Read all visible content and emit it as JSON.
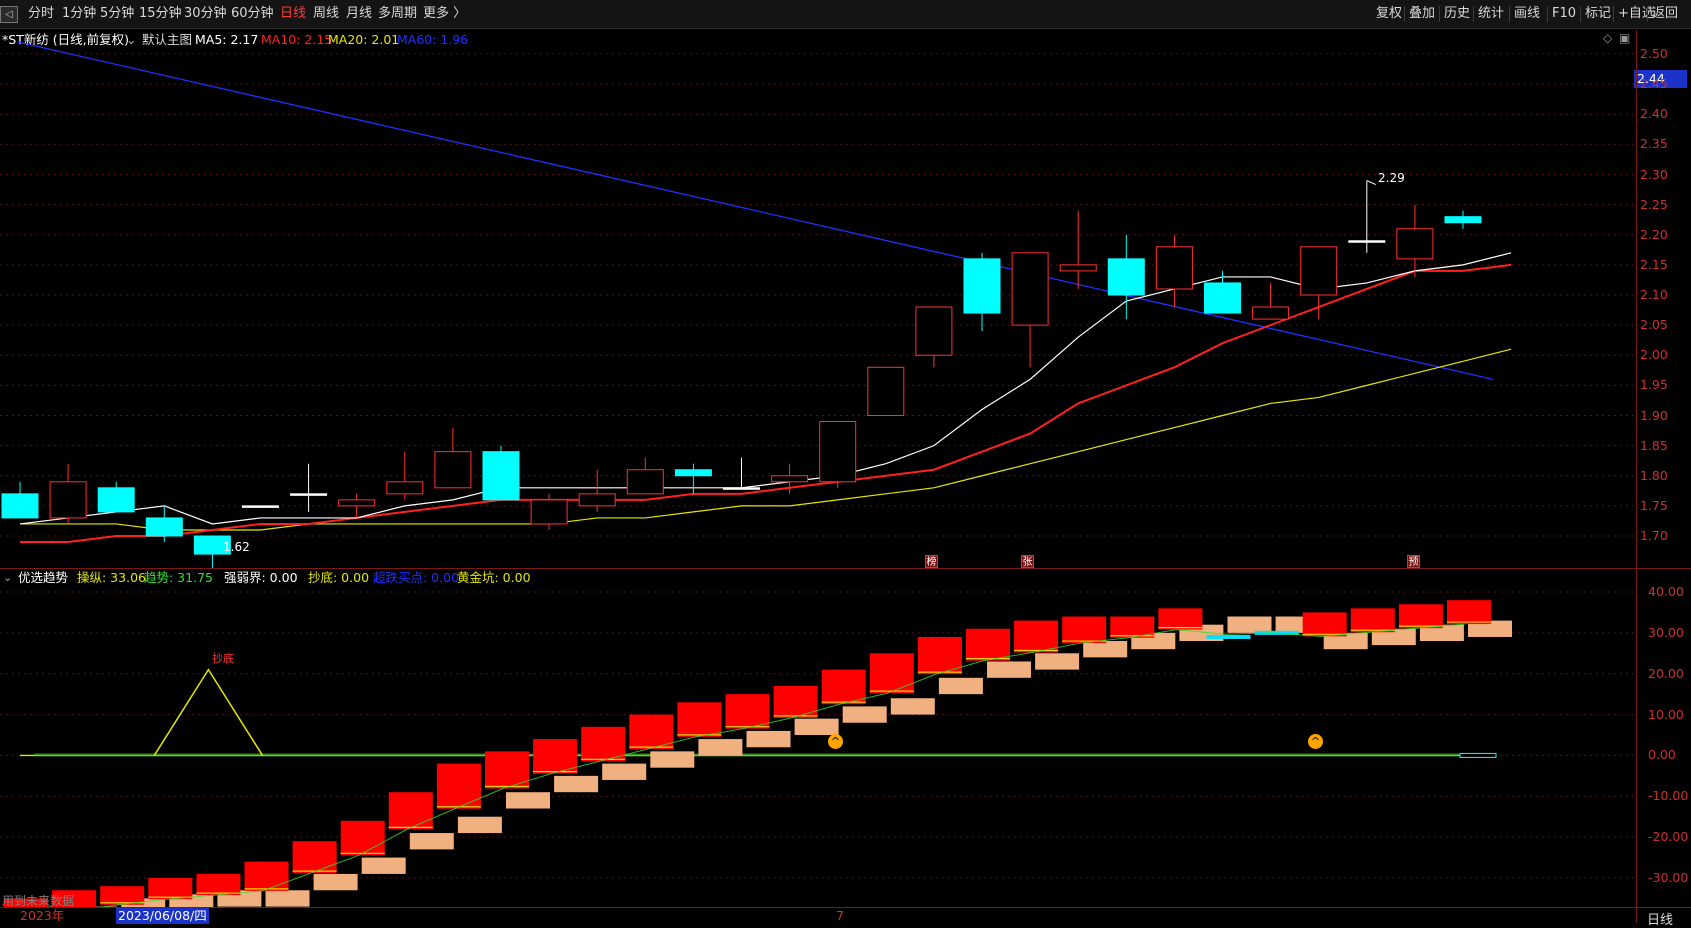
{
  "toolbar": {
    "periods": [
      {
        "label": "分时",
        "active": false
      },
      {
        "label": "1分钟",
        "active": false
      },
      {
        "label": "5分钟",
        "active": false
      },
      {
        "label": "15分钟",
        "active": false
      },
      {
        "label": "30分钟",
        "active": false
      },
      {
        "label": "60分钟",
        "active": false
      },
      {
        "label": "日线",
        "active": true
      },
      {
        "label": "周线",
        "active": false
      },
      {
        "label": "月线",
        "active": false
      },
      {
        "label": "多周期",
        "active": false
      },
      {
        "label": "更多 〉",
        "active": false
      }
    ],
    "actions": [
      "复权",
      "叠加",
      "历史",
      "统计",
      "画线",
      "F10",
      "标记",
      "+自选",
      "返回"
    ]
  },
  "main_chart": {
    "title": "*ST新纺 (日线,前复权)",
    "template": "默认主图",
    "ma5": {
      "label": "MA5: 2.17",
      "color": "#ffffff"
    },
    "ma10": {
      "label": "MA10: 2.15",
      "color": "#ff2020"
    },
    "ma20": {
      "label": "MA20: 2.01",
      "color": "#e6e600"
    },
    "ma60": {
      "label": "MA60: 1.96",
      "color": "#2030ff"
    },
    "current_price": "2.44",
    "high_label": "2.29",
    "low_label": "1.62",
    "price_ticks": [
      "2.50",
      "2.45",
      "2.40",
      "2.35",
      "2.30",
      "2.25",
      "2.20",
      "2.15",
      "2.10",
      "2.05",
      "2.00",
      "1.95",
      "1.90",
      "1.85",
      "1.80",
      "1.75",
      "1.70"
    ],
    "markers": [
      {
        "label": "榜"
      },
      {
        "label": "张"
      },
      {
        "label": "预"
      }
    ],
    "colors": {
      "up": "#ff3030",
      "down": "#00ffff",
      "background": "#000000",
      "grid": "#5a1010"
    }
  },
  "chart_data": {
    "type": "candlestick",
    "ylim": [
      1.6,
      2.52
    ],
    "candles": [
      {
        "o": 1.77,
        "h": 1.79,
        "l": 1.73,
        "c": 1.73
      },
      {
        "o": 1.73,
        "h": 1.82,
        "l": 1.72,
        "c": 1.79
      },
      {
        "o": 1.78,
        "h": 1.79,
        "l": 1.74,
        "c": 1.74
      },
      {
        "o": 1.73,
        "h": 1.75,
        "l": 1.69,
        "c": 1.7
      },
      {
        "o": 1.7,
        "h": 1.7,
        "l": 1.62,
        "c": 1.67
      },
      {
        "o": 1.75,
        "h": 1.75,
        "l": 1.75,
        "c": 1.75
      },
      {
        "o": 1.77,
        "h": 1.82,
        "l": 1.74,
        "c": 1.77
      },
      {
        "o": 1.75,
        "h": 1.77,
        "l": 1.73,
        "c": 1.76
      },
      {
        "o": 1.77,
        "h": 1.84,
        "l": 1.76,
        "c": 1.79
      },
      {
        "o": 1.78,
        "h": 1.88,
        "l": 1.78,
        "c": 1.84
      },
      {
        "o": 1.84,
        "h": 1.85,
        "l": 1.76,
        "c": 1.76
      },
      {
        "o": 1.72,
        "h": 1.77,
        "l": 1.71,
        "c": 1.76
      },
      {
        "o": 1.75,
        "h": 1.81,
        "l": 1.74,
        "c": 1.77
      },
      {
        "o": 1.77,
        "h": 1.83,
        "l": 1.77,
        "c": 1.81
      },
      {
        "o": 1.81,
        "h": 1.82,
        "l": 1.77,
        "c": 1.8
      },
      {
        "o": 1.78,
        "h": 1.83,
        "l": 1.78,
        "c": 1.78
      },
      {
        "o": 1.79,
        "h": 1.82,
        "l": 1.77,
        "c": 1.8
      },
      {
        "o": 1.79,
        "h": 1.89,
        "l": 1.78,
        "c": 1.89
      },
      {
        "o": 1.9,
        "h": 1.98,
        "l": 1.9,
        "c": 1.98
      },
      {
        "o": 2.0,
        "h": 2.08,
        "l": 1.98,
        "c": 2.08
      },
      {
        "o": 2.16,
        "h": 2.17,
        "l": 2.04,
        "c": 2.07
      },
      {
        "o": 2.05,
        "h": 2.17,
        "l": 1.98,
        "c": 2.17
      },
      {
        "o": 2.14,
        "h": 2.24,
        "l": 2.11,
        "c": 2.15
      },
      {
        "o": 2.16,
        "h": 2.2,
        "l": 2.06,
        "c": 2.1
      },
      {
        "o": 2.11,
        "h": 2.2,
        "l": 2.08,
        "c": 2.18
      },
      {
        "o": 2.12,
        "h": 2.14,
        "l": 2.07,
        "c": 2.07
      },
      {
        "o": 2.06,
        "h": 2.12,
        "l": 2.06,
        "c": 2.08
      },
      {
        "o": 2.1,
        "h": 2.18,
        "l": 2.06,
        "c": 2.18
      },
      {
        "o": 2.19,
        "h": 2.29,
        "l": 2.17,
        "c": 2.19
      },
      {
        "o": 2.16,
        "h": 2.25,
        "l": 2.13,
        "c": 2.21
      },
      {
        "o": 2.23,
        "h": 2.24,
        "l": 2.21,
        "c": 2.22
      }
    ],
    "ma5": [
      1.72,
      1.73,
      1.74,
      1.75,
      1.72,
      1.73,
      1.73,
      1.73,
      1.75,
      1.76,
      1.78,
      1.78,
      1.78,
      1.78,
      1.78,
      1.78,
      1.79,
      1.8,
      1.82,
      1.85,
      1.91,
      1.96,
      2.03,
      2.09,
      2.11,
      2.13,
      2.13,
      2.11,
      2.12,
      2.14,
      2.15,
      2.17
    ],
    "ma10": [
      1.69,
      1.69,
      1.7,
      1.7,
      1.71,
      1.72,
      1.72,
      1.73,
      1.74,
      1.75,
      1.76,
      1.76,
      1.76,
      1.76,
      1.77,
      1.77,
      1.78,
      1.79,
      1.8,
      1.81,
      1.84,
      1.87,
      1.92,
      1.95,
      1.98,
      2.02,
      2.05,
      2.08,
      2.11,
      2.14,
      2.14,
      2.15
    ],
    "ma20": [
      1.72,
      1.72,
      1.72,
      1.71,
      1.71,
      1.71,
      1.72,
      1.72,
      1.72,
      1.72,
      1.72,
      1.72,
      1.73,
      1.73,
      1.74,
      1.75,
      1.75,
      1.76,
      1.77,
      1.78,
      1.8,
      1.82,
      1.84,
      1.86,
      1.88,
      1.9,
      1.92,
      1.93,
      1.95,
      1.97,
      1.99,
      2.01
    ],
    "ma60": {
      "from": 2.52,
      "to": 1.96
    }
  },
  "indicator": {
    "name": "优选趋势",
    "items": [
      {
        "label": "操纵: 33.06",
        "color": "#e6e600"
      },
      {
        "label": "趋势: 31.75",
        "color": "#30e030"
      },
      {
        "label": "强弱界: 0.00",
        "color": "#ffffff"
      },
      {
        "label": "抄底: 0.00",
        "color": "#e6e600"
      },
      {
        "label": "超跌买点: 0.00",
        "color": "#2030ff"
      },
      {
        "label": "黄金坑: 0.00",
        "color": "#e6e600"
      }
    ],
    "peak_label": "抄底",
    "ticks": [
      "40.00",
      "30.00",
      "20.00",
      "10.00",
      "0.00",
      "-10.00",
      "-20.00",
      "-30.00"
    ],
    "ylim": [
      -42,
      45
    ],
    "bars": [
      {
        "t": -35,
        "b": -41
      },
      {
        "t": -33,
        "b": -41
      },
      {
        "t": -32,
        "b": -39
      },
      {
        "t": -30,
        "b": -38
      },
      {
        "t": -29,
        "b": -37
      },
      {
        "t": -26,
        "b": -37
      },
      {
        "t": -21,
        "b": -33
      },
      {
        "t": -16,
        "b": -29
      },
      {
        "t": -9,
        "b": -23
      },
      {
        "t": -2,
        "b": -19
      },
      {
        "t": 1,
        "b": -13
      },
      {
        "t": 4,
        "b": -9
      },
      {
        "t": 7,
        "b": -6
      },
      {
        "t": 10,
        "b": -3
      },
      {
        "t": 13,
        "b": 0
      },
      {
        "t": 15,
        "b": 2
      },
      {
        "t": 17,
        "b": 5
      },
      {
        "t": 21,
        "b": 8
      },
      {
        "t": 25,
        "b": 10
      },
      {
        "t": 29,
        "b": 15
      },
      {
        "t": 31,
        "b": 19
      },
      {
        "t": 33,
        "b": 21
      },
      {
        "t": 34,
        "b": 24
      },
      {
        "t": 34,
        "b": 26
      },
      {
        "t": 36,
        "b": 28
      },
      {
        "t": 29,
        "b": 30
      },
      {
        "t": 30,
        "b": 30
      },
      {
        "t": 35,
        "b": 26
      },
      {
        "t": 36,
        "b": 27
      },
      {
        "t": 37,
        "b": 28
      },
      {
        "t": 38,
        "b": 29
      }
    ],
    "peak_value": 21,
    "alert_icons": [
      {
        "label": "^"
      },
      {
        "label": "^"
      }
    ]
  },
  "footer": {
    "future_label": "用到未来数据",
    "year_label": "2023年",
    "date_label": "2023/06/08/四",
    "month_label": "7",
    "period_label": "日线"
  }
}
